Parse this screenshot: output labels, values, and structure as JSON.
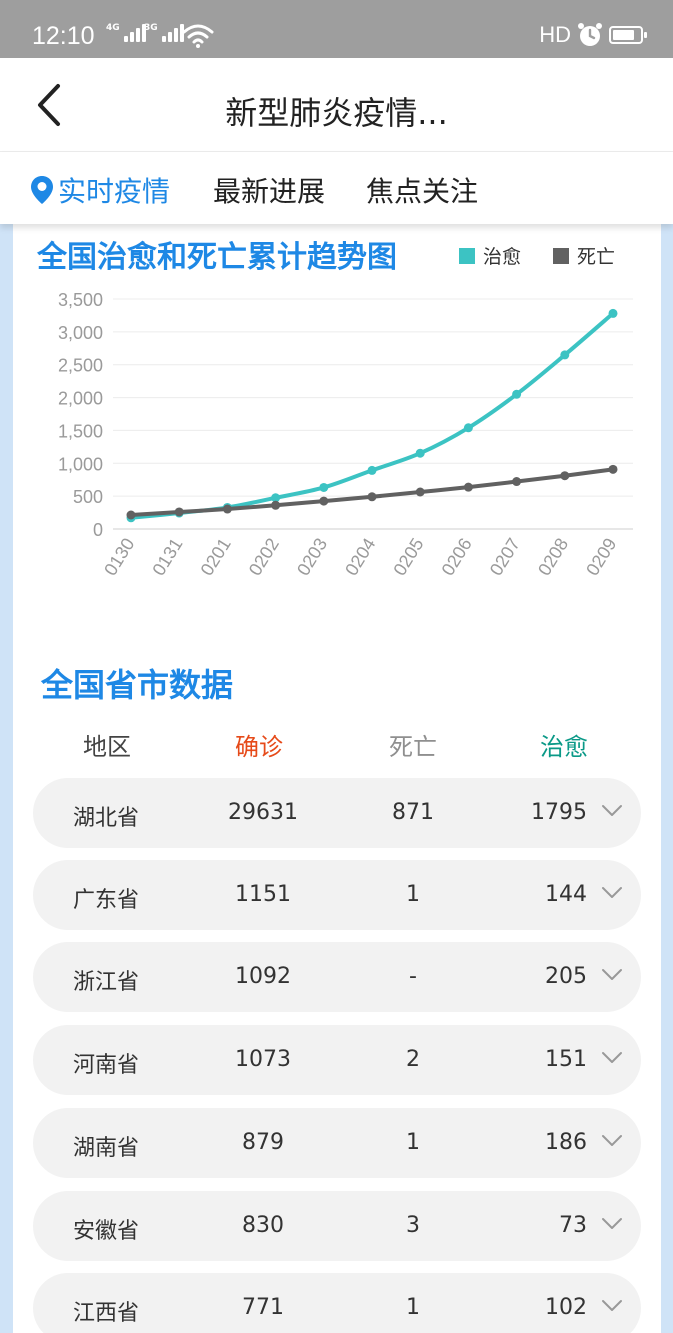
{
  "status": {
    "time": "12:10",
    "net1": "4G",
    "net2": "3G",
    "hd": "HD"
  },
  "header": {
    "title": "新型肺炎疫情..."
  },
  "tabs": [
    {
      "label": "实时疫情",
      "active": true
    },
    {
      "label": "最新进展",
      "active": false
    },
    {
      "label": "焦点关注",
      "active": false
    }
  ],
  "chart": {
    "title": "全国治愈和死亡累计趋势图",
    "legend": [
      {
        "name": "治愈",
        "color": "#3cc3c3"
      },
      {
        "name": "死亡",
        "color": "#616161"
      }
    ]
  },
  "chart_data": {
    "type": "line",
    "title": "全国治愈和死亡累计趋势图",
    "categories": [
      "0130",
      "0131",
      "0201",
      "0202",
      "0203",
      "0204",
      "0205",
      "0206",
      "0207",
      "0208",
      "0209"
    ],
    "series": [
      {
        "name": "治愈",
        "color": "#3cc3c3",
        "values": [
          171,
          243,
          328,
          475,
          632,
          892,
          1153,
          1540,
          2050,
          2649,
          3281
        ]
      },
      {
        "name": "死亡",
        "color": "#616161",
        "values": [
          213,
          259,
          304,
          361,
          425,
          490,
          563,
          637,
          722,
          811,
          908
        ]
      }
    ],
    "yticks": [
      "0",
      "500",
      "1,000",
      "1,500",
      "2,000",
      "2,500",
      "3,000",
      "3,500"
    ],
    "ylim": [
      0,
      3500
    ],
    "grid": true,
    "legend_position": "top-right"
  },
  "table": {
    "title": "全国省市数据",
    "headers": [
      "地区",
      "确诊",
      "死亡",
      "治愈"
    ],
    "rows": [
      {
        "region": "湖北省",
        "confirmed": "29631",
        "deaths": "871",
        "cured": "1795"
      },
      {
        "region": "广东省",
        "confirmed": "1151",
        "deaths": "1",
        "cured": "144"
      },
      {
        "region": "浙江省",
        "confirmed": "1092",
        "deaths": "-",
        "cured": "205"
      },
      {
        "region": "河南省",
        "confirmed": "1073",
        "deaths": "2",
        "cured": "151"
      },
      {
        "region": "湖南省",
        "confirmed": "879",
        "deaths": "1",
        "cured": "186"
      },
      {
        "region": "安徽省",
        "confirmed": "830",
        "deaths": "3",
        "cured": "73"
      },
      {
        "region": "江西省",
        "confirmed": "771",
        "deaths": "1",
        "cured": "102"
      }
    ]
  },
  "icons": {
    "back": "chevron-left-icon",
    "location": "location-pin-icon",
    "expand": "chevron-down-icon"
  },
  "colors": {
    "accent": "#1e88e5",
    "cured": "#3cc3c3",
    "death": "#616161",
    "confirmed": "#e64a19"
  }
}
